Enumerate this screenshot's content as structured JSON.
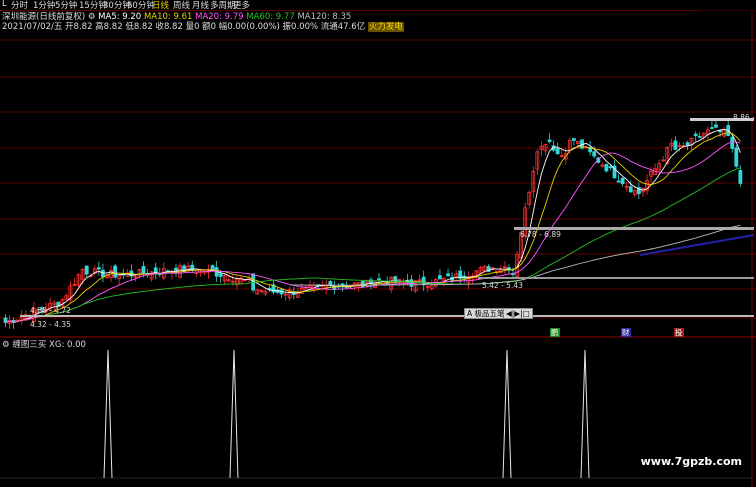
{
  "toolbar": {
    "items": [
      "分时",
      "1分钟",
      "5分钟",
      "15分钟",
      "30分钟",
      "60分钟",
      "日线",
      "周线",
      "月线",
      "多周期",
      "更多"
    ],
    "active_index": 6,
    "edge_label": "L"
  },
  "header": {
    "stock": "深圳能源(日线前复权)",
    "ma5": "MA5: 9.20",
    "ma10": "MA10: 9.61",
    "ma20": "MA20: 9.79",
    "ma60": "MA60: 9.77",
    "ma120": "MA120: 8.35",
    "quote": "2021/07/02/五 开8.82 高8.82 低8.82 收8.82 量0 额0 幅0.00(0.00%) 振0.00% 流通47.6亿",
    "badge": "火力发电"
  },
  "price_labels": {
    "hi": "8.86 -",
    "mid1": "6.78 - 6.89",
    "mid2": "5.42 - 5.43",
    "lo1": "4.68 - 4.72",
    "lo2": "4.32 - 4.35"
  },
  "buttons": {
    "five_level": "A 极品五笔",
    "small": "◀|▶|□"
  },
  "tags": [
    "鹏",
    "财",
    "投"
  ],
  "sub": {
    "title": "缠图三买",
    "xg": "XG: 0.00"
  },
  "watermark": "www.7gpzb.com",
  "colors": {
    "ma5": "#ffffff",
    "ma10": "#e6d200",
    "ma20": "#ff55ff",
    "ma60": "#22c022",
    "ma120": "#bbbbbb",
    "up": "#ff3030",
    "down": "#33d6d6",
    "grid": "#7a0000"
  }
}
